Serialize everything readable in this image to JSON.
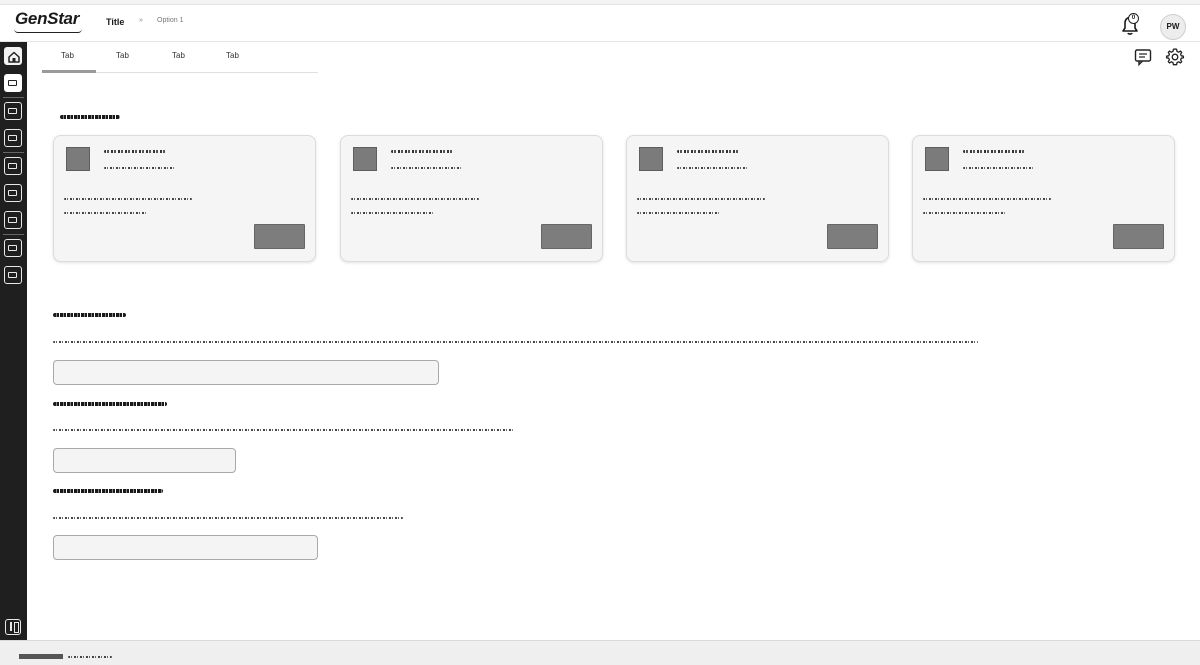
{
  "header": {
    "logo": "GenStar",
    "title": "Title",
    "breadcrumb_separator": "»",
    "breadcrumb_option": "Option 1",
    "notification_count": "0",
    "avatar_initials": "PW"
  },
  "tabs": [
    {
      "label": "Tab"
    },
    {
      "label": "Tab"
    },
    {
      "label": "Tab"
    },
    {
      "label": "Tab"
    }
  ],
  "section1": {
    "heading": "",
    "cards": [
      {
        "thumb_label": "",
        "title": "",
        "subtitle": "",
        "body1": "",
        "body2": "",
        "button_label": ""
      },
      {
        "thumb_label": "",
        "title": "",
        "subtitle": "",
        "body1": "",
        "body2": "",
        "button_label": ""
      },
      {
        "thumb_label": "",
        "title": "",
        "subtitle": "",
        "body1": "",
        "body2": "",
        "button_label": ""
      },
      {
        "thumb_label": "",
        "title": "",
        "subtitle": "",
        "body1": "",
        "body2": "",
        "button_label": ""
      }
    ]
  },
  "form": {
    "fields": [
      {
        "label": "",
        "description": "",
        "value": ""
      },
      {
        "label": "",
        "description": "",
        "value": ""
      },
      {
        "label": "",
        "description": "",
        "value": ""
      }
    ]
  },
  "footer": {
    "text": ""
  },
  "icons": {
    "rail_home": "home-icon",
    "rail_items": "square-box-icon",
    "rail_collapse": "sidebar-toggle-icon",
    "bell": "bell-icon",
    "comment": "comment-icon",
    "settings": "gear-icon"
  },
  "colors": {
    "rail_bg": "#1f1f1f",
    "card_bg": "#f5f5f5",
    "card_button": "#7d7d7d",
    "tab_indicator": "#9a9a9a"
  }
}
